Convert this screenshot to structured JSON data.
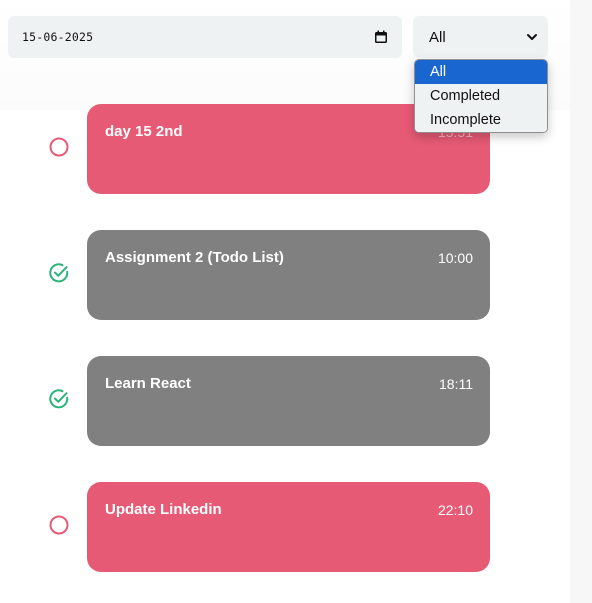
{
  "date_filter": {
    "value": "15-06-2025",
    "icon": "calendar-icon"
  },
  "status_filter": {
    "selected": "All",
    "options": [
      "All",
      "Completed",
      "Incomplete"
    ],
    "open": true
  },
  "todos": [
    {
      "title": "day 15 2nd",
      "time": "15:51",
      "status": "incomplete"
    },
    {
      "title": "Assignment 2 (Todo List)",
      "time": "10:00",
      "status": "completed"
    },
    {
      "title": "Learn React",
      "time": "18:11",
      "status": "completed"
    },
    {
      "title": "Update Linkedin",
      "time": "22:10",
      "status": "incomplete"
    }
  ],
  "colors": {
    "incomplete_card": "#e65a75",
    "completed_card": "#808080",
    "check_green": "#2db37a",
    "circle_pink": "#e65a75",
    "dropdown_highlight": "#1a66d1"
  }
}
